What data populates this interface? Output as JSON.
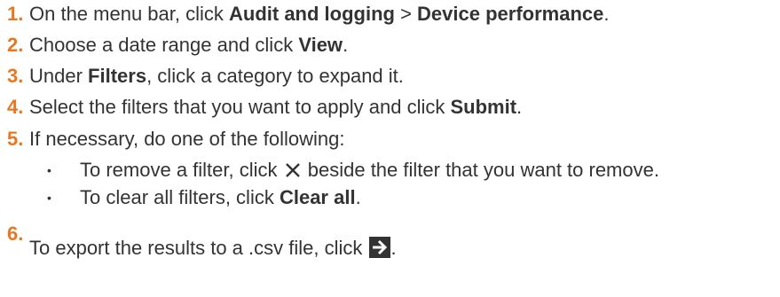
{
  "steps": [
    {
      "num": "1.",
      "pre": "On the menu bar, click ",
      "b1": "Audit and logging",
      "mid": " > ",
      "b2": "Device performance",
      "post": "."
    },
    {
      "num": "2.",
      "pre": "Choose a date range and click ",
      "b1": "View",
      "post": "."
    },
    {
      "num": "3.",
      "pre": "Under ",
      "b1": "Filters",
      "post": ", click a category to expand it."
    },
    {
      "num": "4.",
      "pre": "Select the filters that you want to apply and click ",
      "b1": "Submit",
      "post": "."
    },
    {
      "num": "5.",
      "text": "If necessary, do one of the following:"
    },
    {
      "num": "6.",
      "pre": "To export the results to a .csv file, click ",
      "post": "."
    }
  ],
  "substeps": [
    {
      "bullet": "•",
      "pre": "To remove a filter, click ",
      "post": " beside the filter that you want to remove."
    },
    {
      "bullet": "•",
      "pre": "To clear all filters, click ",
      "b1": "Clear all",
      "post": "."
    }
  ],
  "icons": {
    "remove": "close-icon",
    "export": "export-arrow-icon"
  },
  "colors": {
    "number": "#e87722",
    "text": "#333333"
  }
}
